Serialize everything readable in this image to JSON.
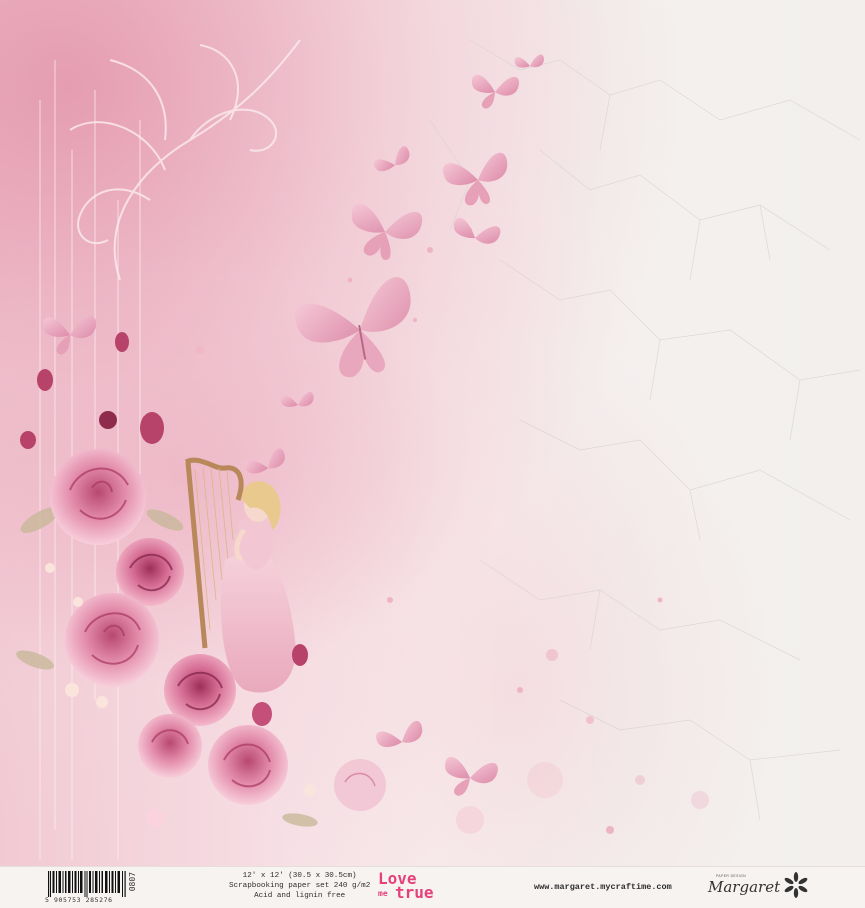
{
  "footer": {
    "barcode_number": "5 905753 285276",
    "sku": "0807",
    "size_line": "12' x 12' (30.5 x 30.5cm)",
    "paper_line": "Scrapbooking paper set 240 g/m2",
    "acid_line": "Acid and lignin free",
    "collection_love": "Love",
    "collection_me": "me",
    "collection_true": "true",
    "website": "www.margaret.mycraftime.com",
    "logo_top": "PAPER DESIGN",
    "logo_script": "Margaret",
    "logo_icon": "flower-logo-icon"
  },
  "artwork": {
    "icons": [
      "butterfly-icon",
      "rose-icon",
      "harp-icon",
      "harpist-figure-icon",
      "swirl-ornament-icon"
    ]
  },
  "colors": {
    "brand_pink": "#e4427b",
    "rose": "#c95a82",
    "rose_light": "#ee9ab5",
    "butterfly": "#e8a3bc",
    "paper": "#f4f1ef"
  }
}
